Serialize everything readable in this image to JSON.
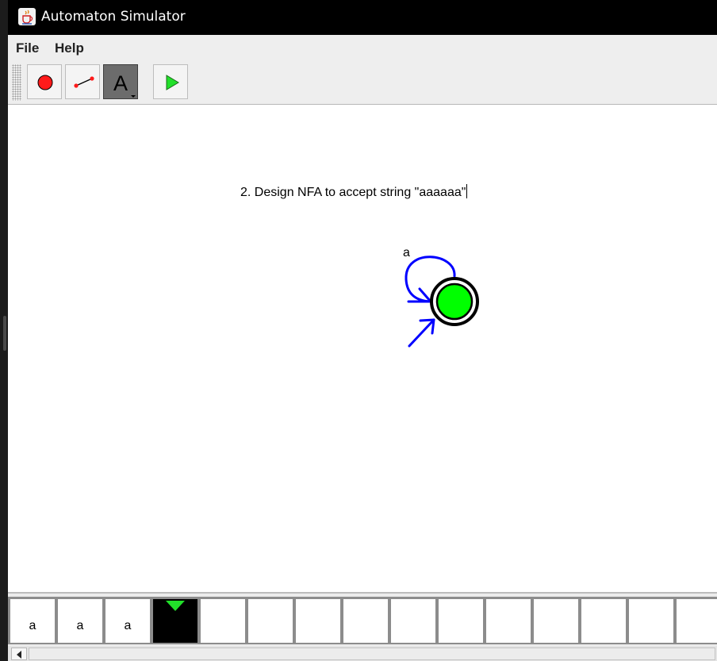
{
  "window": {
    "title": "Automaton Simulator",
    "app_icon": "java-coffee-cup-icon"
  },
  "menu": {
    "items": [
      {
        "label": "File"
      },
      {
        "label": "Help"
      }
    ]
  },
  "toolbar": {
    "tools": [
      {
        "name": "state-tool",
        "icon": "red-circle-icon",
        "selected": false
      },
      {
        "name": "transition-tool",
        "icon": "transition-line-icon",
        "selected": false
      },
      {
        "name": "text-tool",
        "icon": "letter-a-icon",
        "glyph": "A",
        "selected": true
      },
      {
        "name": "run-simulation",
        "icon": "green-play-icon",
        "selected": false
      }
    ]
  },
  "canvas": {
    "annotation": "2. Design NFA to accept string \"aaaaaa\"",
    "states": [
      {
        "initial": true,
        "accepting": true,
        "fill": "#00ff00"
      }
    ],
    "transitions": [
      {
        "from": 0,
        "to": 0,
        "symbol": "a",
        "color": "#0000ff"
      }
    ],
    "colors": {
      "state_fill": "#00ff00",
      "transition": "#0000ff",
      "state_border": "#000000"
    }
  },
  "tape": {
    "cells": [
      "a",
      "a",
      "a",
      "",
      "",
      "",
      "",
      "",
      "",
      "",
      "",
      "",
      "",
      "",
      ""
    ],
    "head_index": 3,
    "head_color": "#22e02a"
  }
}
